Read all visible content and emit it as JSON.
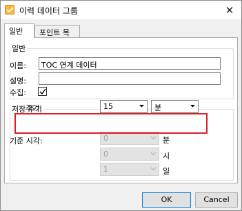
{
  "window": {
    "title": "이력 데이터 그룹",
    "icon": "app-icon",
    "close": "✕"
  },
  "tabs": [
    {
      "label": "일반",
      "selected": true
    },
    {
      "label": "포인트 목록",
      "selected": false
    }
  ],
  "general_group": {
    "label": "일반",
    "name_label": "이름:",
    "name_value": "TOC 연계 데이터",
    "desc_label": "설명:",
    "desc_value": "",
    "collect_label": "수집:",
    "collect_checked": true
  },
  "storage_group": {
    "label": "저장 주기",
    "period_label": "주기:",
    "period_value": "15",
    "period_unit": "분",
    "base_time_label": "기준 시각:",
    "base_rows": [
      {
        "value": "0",
        "unit": "분"
      },
      {
        "value": "0",
        "unit": "시"
      },
      {
        "value": "1",
        "unit": "일"
      }
    ]
  },
  "buttons": {
    "ok": "OK",
    "cancel": "Cancel"
  },
  "colors": {
    "highlight": "#d9202b",
    "default_button_border": "#0078d7"
  }
}
